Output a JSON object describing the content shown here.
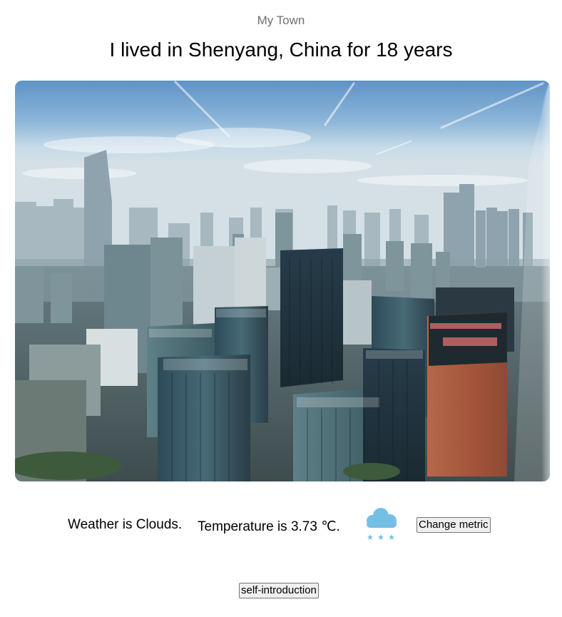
{
  "header": {
    "subtitle": "My Town",
    "headline": "I lived in Shenyang, China for 18 years"
  },
  "weather": {
    "summary": "Weather is Clouds.",
    "temperature": "Temperature is 3.73 ℃.",
    "icon": "snow-cloud-icon",
    "icon_color": "#74c0e4",
    "change_metric_label": "Change metric"
  },
  "footer": {
    "intro_label": "self-introduction"
  }
}
